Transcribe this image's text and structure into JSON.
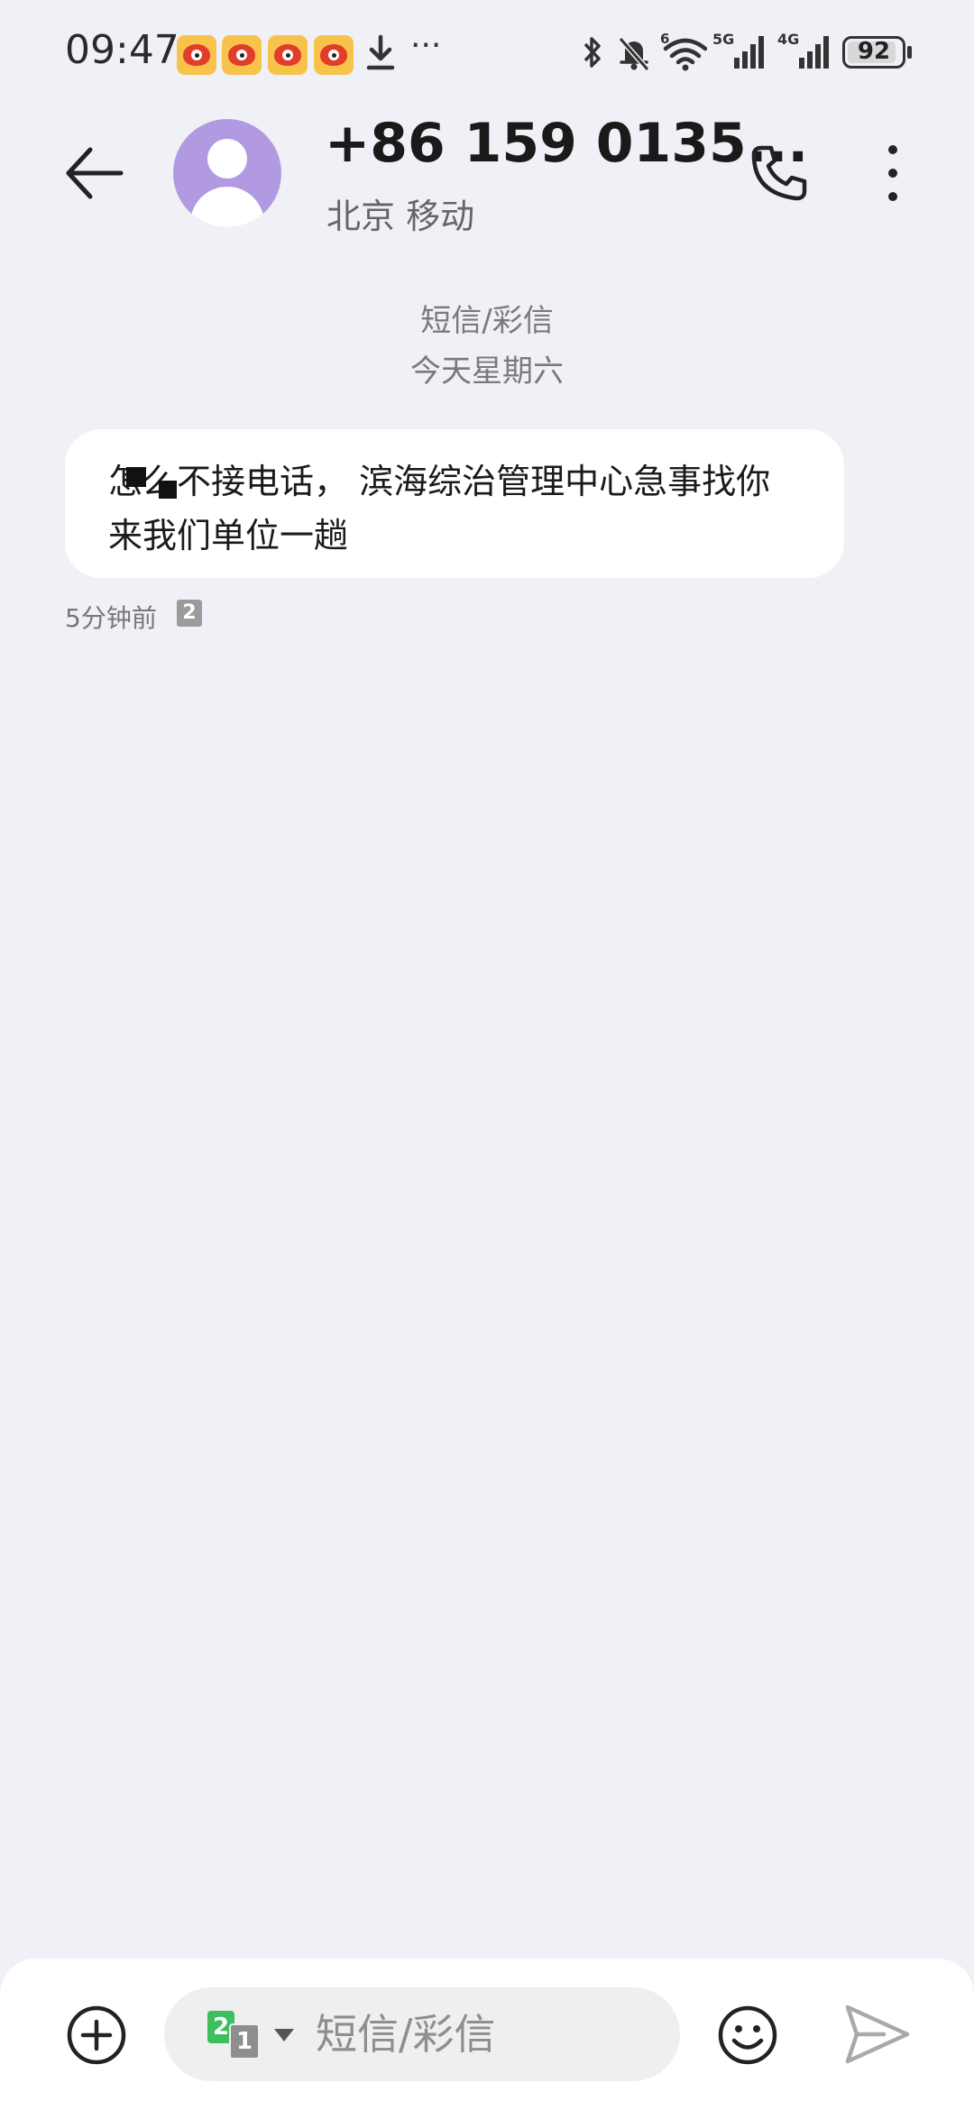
{
  "status_bar": {
    "time": "09:47",
    "notification_icons": [
      "weibo-icon",
      "weibo-icon",
      "weibo-icon",
      "weibo-icon",
      "download-icon",
      "more-icon"
    ],
    "more_glyph": "···",
    "system_icons": [
      "bluetooth-icon",
      "bell-muted-icon",
      "wifi-6-icon",
      "signal-5g-icon",
      "signal-4g-icon"
    ],
    "network_labels": {
      "wifi": "6",
      "sim1": "5G",
      "sim2": "4G"
    },
    "battery_level": "92",
    "battery_fraction": 0.92
  },
  "header": {
    "contact_name": "+86 159 0135...",
    "carrier": "北京 移动"
  },
  "conversation": {
    "message_type": "短信/彩信",
    "date_label": "今天星期六",
    "messages": [
      {
        "text": "怎么不接电话， 滨海综治管理中心急事找你 来我们单位一趟",
        "time": "5分钟前",
        "sim_badge": "2"
      }
    ]
  },
  "composer": {
    "placeholder": "短信/彩信",
    "sim_primary": "2",
    "sim_secondary": "1"
  },
  "colors": {
    "background": "#f0f1f6",
    "avatar": "#b29ae3",
    "sim2_green": "#3cbf5c"
  }
}
